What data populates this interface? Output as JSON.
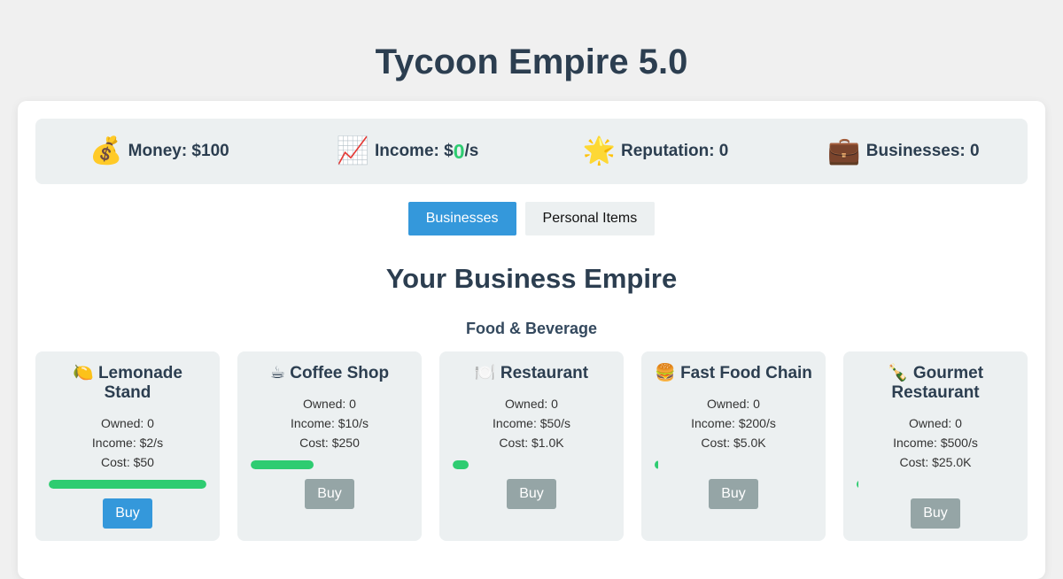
{
  "app": {
    "title": "Tycoon Empire 5.0"
  },
  "stats": {
    "money_label": "Money: $100",
    "income_prefix": "Income: $",
    "income_value": "0",
    "income_suffix": "/s",
    "reputation_label": "Reputation: 0",
    "businesses_label": "Businesses: 0",
    "icons": {
      "money": "money-bag-icon",
      "income": "chart-increasing-icon",
      "reputation": "star-icon",
      "businesses": "briefcase-icon"
    }
  },
  "tabs": [
    {
      "label": "Businesses",
      "active": true
    },
    {
      "label": "Personal Items",
      "active": false
    }
  ],
  "main": {
    "section_title": "Your Business Empire",
    "category_title": "Food & Beverage"
  },
  "businesses": [
    {
      "emoji": "🍋",
      "name": "Lemonade Stand",
      "owned": "Owned: 0",
      "income": "Income: $2/s",
      "cost": "Cost: $50",
      "progress_percent": 100,
      "buy_label": "Buy",
      "affordable": true
    },
    {
      "emoji": "☕",
      "name": "Coffee Shop",
      "owned": "Owned: 0",
      "income": "Income: $10/s",
      "cost": "Cost: $250",
      "progress_percent": 40,
      "buy_label": "Buy",
      "affordable": false
    },
    {
      "emoji": "🍽️",
      "name": "Restaurant",
      "owned": "Owned: 0",
      "income": "Income: $50/s",
      "cost": "Cost: $1.0K",
      "progress_percent": 10,
      "buy_label": "Buy",
      "affordable": false
    },
    {
      "emoji": "🍔",
      "name": "Fast Food Chain",
      "owned": "Owned: 0",
      "income": "Income: $200/s",
      "cost": "Cost: $5.0K",
      "progress_percent": 2,
      "buy_label": "Buy",
      "affordable": false
    },
    {
      "emoji": "🍾",
      "name": "Gourmet Restaurant",
      "owned": "Owned: 0",
      "income": "Income: $500/s",
      "cost": "Cost: $25.0K",
      "progress_percent": 0.4,
      "buy_label": "Buy",
      "affordable": false
    }
  ],
  "colors": {
    "accent": "#3498db",
    "progress": "#2ecc71",
    "disabled_button": "#95a5a6",
    "income_value": "#2ecc71"
  }
}
